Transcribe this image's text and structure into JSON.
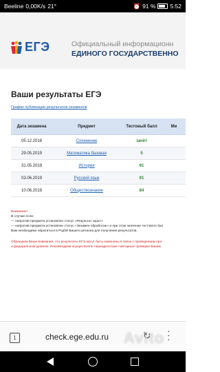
{
  "statusbar": {
    "carrier": "Beeline",
    "net": "0,00K/s",
    "temp": "21°",
    "battery": "91 %",
    "time": "5:52"
  },
  "header": {
    "logo_text": "ЕГЭ",
    "line1": "Официальный информационн",
    "line2": "ЕДИНОГО ГОСУДАРСТВЕННО"
  },
  "results": {
    "title": "Ваши результаты ЕГЭ",
    "schedule_link": "График публикации результатов экзаменов",
    "columns": [
      "Дата экзамена",
      "Предмет",
      "Тестовый балл",
      "Ми"
    ],
    "rows": [
      {
        "date": "05.12.2018",
        "subject": "Сочинение",
        "score": "зачёт"
      },
      {
        "date": "29.05.2019",
        "subject": "Математика базовая",
        "score": "5"
      },
      {
        "date": "31.05.2019",
        "subject": "История",
        "score": "91"
      },
      {
        "date": "03.06.2019",
        "subject": "Русский язык",
        "score": "91"
      },
      {
        "date": "10.06.2019",
        "subject": "Обществознание",
        "score": "84"
      }
    ]
  },
  "notes": {
    "attention": "Внимание!",
    "in_case": "В случае если:",
    "item1": "— напротив предмета установлен статус «Результат скрыт»",
    "item2": "— напротив предмета установлен статус «Экзамен обработан» и при этом значение тестового бал",
    "item3": "Вам необходимо обратиться в РЦОИ Вашего региона для получения результатов.",
    "warn1": "Обращаем Ваше внимание, что результаты ЕГЭ могут быть изменены в связи с проведением про",
    "warn2": "и федеральном уровнях. Рекомендуем осуществлять периодические повторные проверки Вашик"
  },
  "browser": {
    "tabs_count": "1",
    "url": "check.ege.edu.ru"
  },
  "watermark": "Avito",
  "colors": {
    "brand_blue": "#1e5aa8",
    "header_bg": "#f3f3f3",
    "table_head": "#d7e3f3",
    "score_green": "#2d8a2d",
    "link_blue": "#1d5fb0",
    "warning_red": "#cc1f1f"
  }
}
